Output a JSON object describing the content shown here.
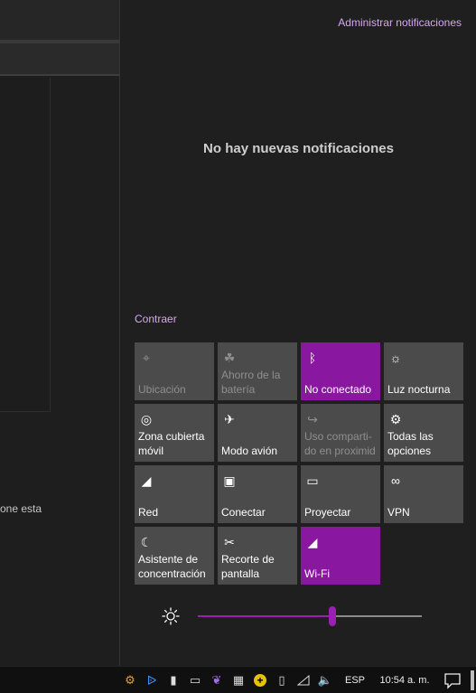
{
  "background_app": {
    "partial_text": "one esta"
  },
  "action_center": {
    "manage_label": "Administrar notificaciones",
    "empty_message": "No hay nuevas notificaciones",
    "collapse_label": "Contraer",
    "tiles": [
      {
        "label": "Ubicación",
        "icon": "location-icon",
        "state": "disabled"
      },
      {
        "label": "Ahorro de la\nbatería",
        "icon": "battery-saver-icon",
        "state": "disabled"
      },
      {
        "label": "No conectado",
        "icon": "bluetooth-icon",
        "state": "active"
      },
      {
        "label": "Luz nocturna",
        "icon": "night-light-icon",
        "state": "off"
      },
      {
        "label": "Zona cubierta\nmóvil",
        "icon": "mobile-hotspot-icon",
        "state": "off"
      },
      {
        "label": "Modo avión",
        "icon": "airplane-icon",
        "state": "off"
      },
      {
        "label": "Uso comparti-\ndo en proximid",
        "icon": "nearby-sharing-icon",
        "state": "disabled"
      },
      {
        "label": "Todas las\nopciones",
        "icon": "settings-icon",
        "state": "off"
      },
      {
        "label": "Red",
        "icon": "network-icon",
        "state": "off"
      },
      {
        "label": "Conectar",
        "icon": "connect-icon",
        "state": "off"
      },
      {
        "label": "Proyectar",
        "icon": "project-icon",
        "state": "off"
      },
      {
        "label": "VPN",
        "icon": "vpn-icon",
        "state": "off"
      },
      {
        "label": "Asistente de\nconcentración",
        "icon": "focus-assist-icon",
        "state": "off"
      },
      {
        "label": "Recorte de\npantalla",
        "icon": "screen-snip-icon",
        "state": "off"
      },
      {
        "label": "Wi-Fi",
        "icon": "wifi-icon",
        "state": "active"
      }
    ],
    "brightness": {
      "level": 0.6
    }
  },
  "taskbar": {
    "tray_icons": [
      "app-icon",
      "bluetooth-tray-icon",
      "usb-icon",
      "display-icon",
      "feather-icon",
      "film-icon",
      "plus-icon",
      "battery-icon",
      "wifi-tray-icon",
      "volume-icon"
    ],
    "language": "ESP",
    "time": "10:54 a. m."
  },
  "colors": {
    "accent": "#8a17a0",
    "link": "#d6a7f2",
    "tile": "#4b4b4b"
  }
}
